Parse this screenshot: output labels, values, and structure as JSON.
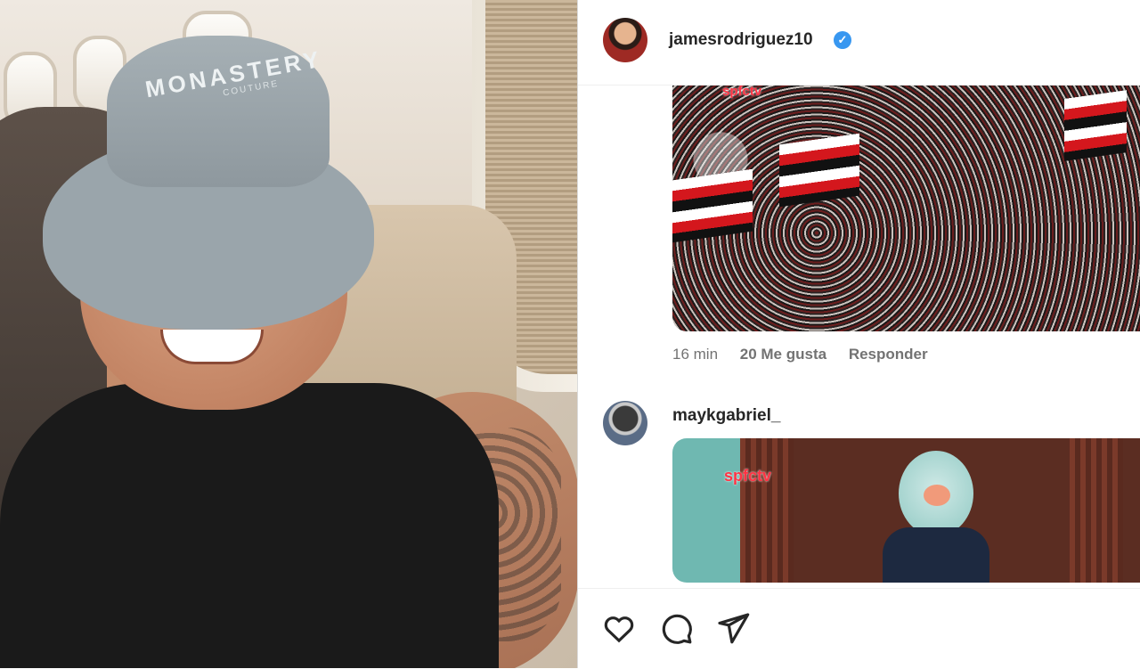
{
  "photo": {
    "hat_brand": "MONASTERY",
    "hat_subtext": "COUTURE"
  },
  "post": {
    "author": "jamesrodriguez10",
    "verified": true
  },
  "comments": [
    {
      "media_watermark": "spfctv",
      "time": "16 min",
      "likes": "20 Me gusta",
      "reply_label": "Responder"
    },
    {
      "username": "maykgabriel_",
      "media_watermark": "spfctv"
    }
  ],
  "actions": {
    "like_icon": "heart-icon",
    "comment_icon": "comment-icon",
    "share_icon": "send-icon"
  },
  "colors": {
    "verified_blue": "#3897f0",
    "text_primary": "#262626",
    "text_secondary": "#737373",
    "border": "#dbdbdb"
  }
}
